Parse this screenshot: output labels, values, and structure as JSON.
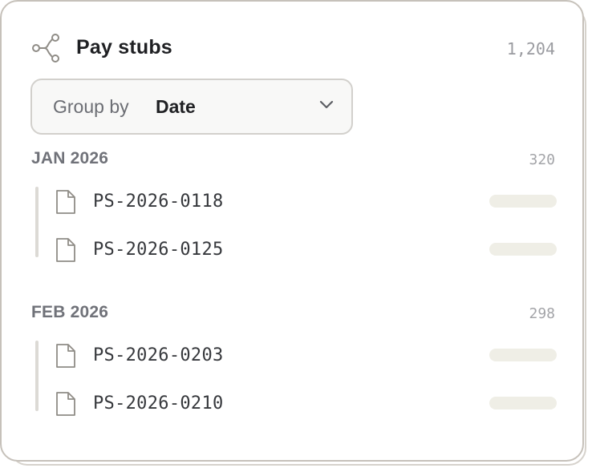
{
  "panel": {
    "title": "Pay stubs",
    "total_count": "1,204",
    "icon": "share-nodes-icon"
  },
  "group_by": {
    "label": "Group by",
    "value": "Date",
    "icon": "chevron-down-icon"
  },
  "groups": [
    {
      "name": "JAN 2026",
      "count": "320",
      "items": [
        {
          "filename": "PS-2026-0118",
          "icon": "file-icon"
        },
        {
          "filename": "PS-2026-0125",
          "icon": "file-icon"
        }
      ]
    },
    {
      "name": "FEB 2026",
      "count": "298",
      "items": [
        {
          "filename": "PS-2026-0203",
          "icon": "file-icon"
        },
        {
          "filename": "PS-2026-0210",
          "icon": "file-icon"
        }
      ]
    }
  ],
  "colors": {
    "border": "#c6c1ba",
    "placeholder_pill": "#efeee6",
    "text_primary": "#1f2023",
    "text_muted": "#707279"
  }
}
